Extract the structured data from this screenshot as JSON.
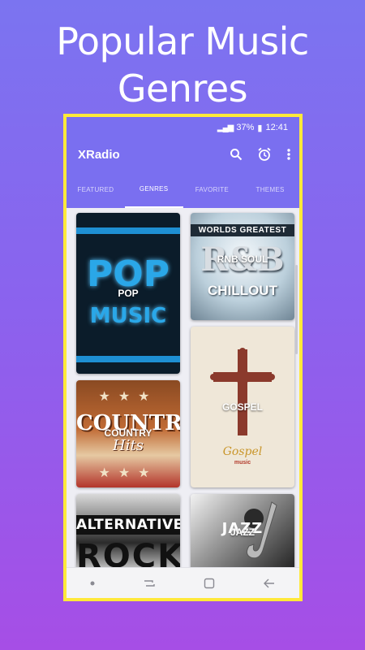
{
  "promo": {
    "title_line1": "Popular Music",
    "title_line2": "Genres"
  },
  "status_bar": {
    "battery": "37%",
    "time": "12:41"
  },
  "app_bar": {
    "title": "XRadio",
    "actions": [
      "search-icon",
      "alarm-icon",
      "more-vert-icon"
    ]
  },
  "tabs": [
    {
      "label": "FEATURED",
      "active": false
    },
    {
      "label": "GENRES",
      "active": true
    },
    {
      "label": "FAVORITE",
      "active": false
    },
    {
      "label": "THEMES",
      "active": false
    }
  ],
  "genres": [
    {
      "name": "POP",
      "artwork_text": [
        "POP",
        "MUSIC"
      ]
    },
    {
      "name": "RNB SOUL",
      "artwork_text": [
        "WORLDS GREATEST",
        "R&B",
        "CHILLOUT"
      ]
    },
    {
      "name": "GOSPEL",
      "artwork_text": [
        "Gospel",
        "music"
      ]
    },
    {
      "name": "COUNTRY",
      "artwork_text": [
        "COUNTRY",
        "Hits"
      ]
    },
    {
      "name": "ALTERNATIVE",
      "artwork_text": [
        "ALTERNATIVE",
        "ROCK"
      ]
    },
    {
      "name": "JAZZ",
      "artwork_text": [
        "JAZZ"
      ]
    }
  ],
  "colors": {
    "accent": "#7a6ff0",
    "frame_border": "#ffe93a",
    "background_top": "#7b74f0",
    "background_bottom": "#a64ee6"
  },
  "nav_bar": {
    "icons": [
      "dot-icon",
      "recents-icon",
      "home-icon",
      "back-icon"
    ]
  }
}
